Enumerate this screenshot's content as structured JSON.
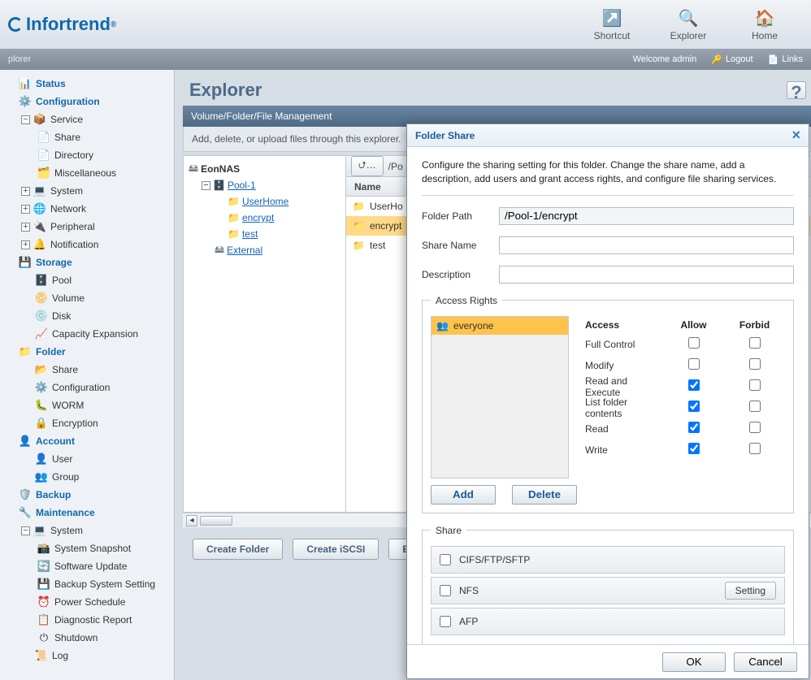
{
  "brand": "Infortrend",
  "topnav": {
    "shortcut": "Shortcut",
    "explorer": "Explorer",
    "home": "Home"
  },
  "statusbar": {
    "crumb": "plorer",
    "welcome": "Welcome admin",
    "logout": "Logout",
    "links": "Links"
  },
  "sidebar": {
    "status": "Status",
    "configuration": "Configuration",
    "service": "Service",
    "share": "Share",
    "directory": "Directory",
    "misc": "Miscellaneous",
    "system": "System",
    "network": "Network",
    "peripheral": "Peripheral",
    "notification": "Notification",
    "storage": "Storage",
    "pool": "Pool",
    "volume": "Volume",
    "disk": "Disk",
    "capexp": "Capacity Expansion",
    "folder": "Folder",
    "fshare": "Share",
    "fconfig": "Configuration",
    "worm": "WORM",
    "encryption": "Encryption",
    "account": "Account",
    "user": "User",
    "group": "Group",
    "backup": "Backup",
    "maintenance": "Maintenance",
    "msystem": "System",
    "snapshot": "System Snapshot",
    "swupdate": "Software Update",
    "backupsys": "Backup System Setting",
    "power": "Power Schedule",
    "diag": "Diagnostic Report",
    "shutdown": "Shutdown",
    "log": "Log"
  },
  "page": {
    "title": "Explorer",
    "subtitle": "Volume/Folder/File Management",
    "desc": "Add, delete, or upload files through this explorer.",
    "pathPrefix": "/Po",
    "colName": "Name",
    "root": "EonNAS",
    "pool": "Pool-1",
    "userhome": "UserHome",
    "encrypt": "encrypt",
    "test": "test",
    "external": "External",
    "rows": {
      "r1": "UserHo",
      "r2": "encrypt",
      "r3": "test"
    },
    "btns": {
      "create": "Create Folder",
      "iscsi": "Create iSCSI",
      "edit": "Ed"
    }
  },
  "modal": {
    "title": "Folder Share",
    "intro": "Configure the sharing setting for this folder. Change the share name, add a description, add users and grant access rights, and configure file sharing services.",
    "folderPathLabel": "Folder Path",
    "folderPathValue": "/Pool-1/encrypt",
    "shareNameLabel": "Share Name",
    "shareNameValue": "",
    "descLabel": "Description",
    "descValue": "",
    "accessLegend": "Access Rights",
    "everyone": "everyone",
    "cols": {
      "access": "Access",
      "allow": "Allow",
      "forbid": "Forbid"
    },
    "perms": {
      "full": {
        "label": "Full Control",
        "allow": false,
        "forbid": false
      },
      "modify": {
        "label": "Modify",
        "allow": false,
        "forbid": false
      },
      "readexec": {
        "label": "Read and Execute",
        "allow": true,
        "forbid": false
      },
      "listfolder": {
        "label": "List folder contents",
        "allow": true,
        "forbid": false
      },
      "read": {
        "label": "Read",
        "allow": true,
        "forbid": false
      },
      "write": {
        "label": "Write",
        "allow": true,
        "forbid": false
      }
    },
    "addBtn": "Add",
    "delBtn": "Delete",
    "shareLegend": "Share",
    "shares": {
      "cifs": "CIFS/FTP/SFTP",
      "nfs": "NFS",
      "afp": "AFP",
      "setting": "Setting"
    },
    "ok": "OK",
    "cancel": "Cancel"
  }
}
